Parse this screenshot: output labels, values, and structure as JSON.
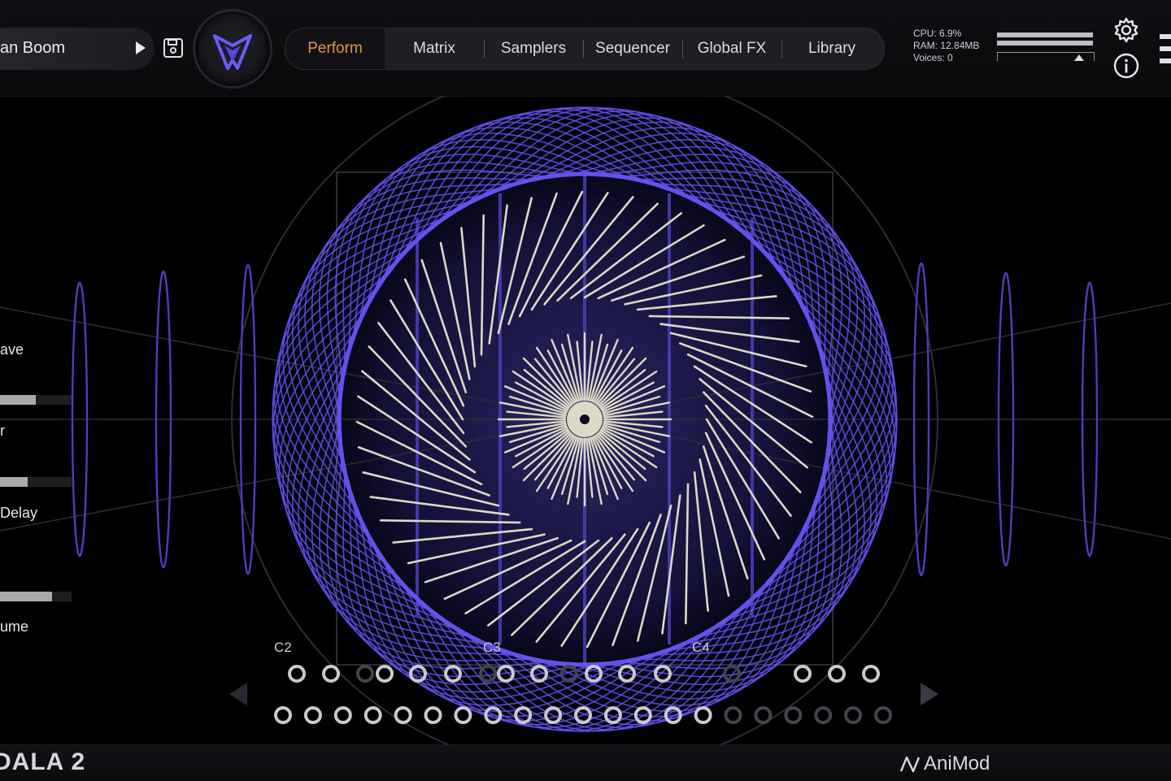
{
  "header": {
    "preset_name": "an Boom",
    "tabs": [
      {
        "label": "Perform",
        "active": true
      },
      {
        "label": "Matrix",
        "active": false
      },
      {
        "label": "Samplers",
        "active": false
      },
      {
        "label": "Sequencer",
        "active": false
      },
      {
        "label": "Global FX",
        "active": false
      },
      {
        "label": "Library",
        "active": false
      }
    ],
    "cpu": "CPU: 6.9%",
    "ram": "RAM: 12.84MB",
    "voices": "Voices: 0",
    "icons": {
      "play": "play-icon",
      "save": "save-icon",
      "logo": "logo-icon",
      "settings": "gear-icon",
      "info": "info-icon",
      "menu": "menu-icon"
    }
  },
  "side_panel": {
    "controls": [
      {
        "label": "ave",
        "level": 0.5
      },
      {
        "label": "r",
        "level": 0.38
      },
      {
        "label": " Delay",
        "level": 0.72
      },
      {
        "label": "ume",
        "level": null
      }
    ]
  },
  "keyboard": {
    "note_labels": [
      "C2",
      "C3",
      "C4"
    ],
    "upper_row": [
      1,
      1,
      0,
      1,
      1,
      1,
      0,
      1,
      1,
      0,
      1,
      1,
      1,
      0,
      1,
      1,
      1
    ],
    "lower_row": [
      1,
      1,
      1,
      1,
      1,
      1,
      1,
      1,
      1,
      1,
      1,
      1,
      1,
      1,
      1,
      0,
      0,
      0,
      0,
      0,
      0
    ],
    "nav_icons": [
      "arrow-left-icon",
      "arrow-right-icon"
    ]
  },
  "footer": {
    "title": "DALA 2",
    "brand": "AniMod"
  },
  "colors": {
    "accent": "#e4923c",
    "visualizer": "#6152f0",
    "visualizer_dim": "#4a3fbd",
    "spokes": "#ddd9c4",
    "background": "#000000"
  }
}
